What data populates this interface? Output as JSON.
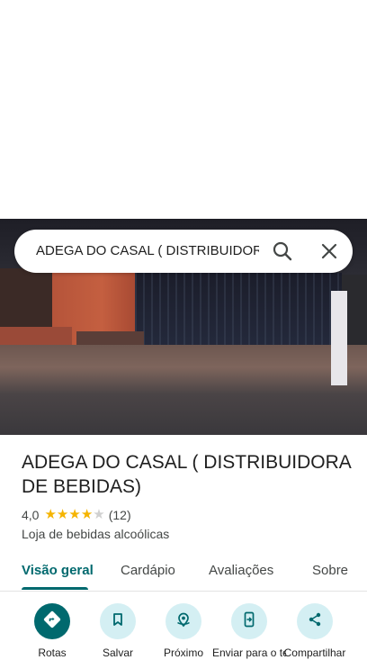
{
  "search": {
    "query": "ADEGA DO CASAL ( DISTRIBUIDORA DE BEBIDAS)"
  },
  "place": {
    "name": "ADEGA DO CASAL ( DISTRIBUIDORA DE BEBIDAS)",
    "rating": "4,0",
    "rating_stars": 4,
    "review_count": "(12)",
    "category": "Loja de bebidas alcoólicas"
  },
  "tabs": [
    {
      "label": "Visão geral",
      "active": true
    },
    {
      "label": "Cardápio",
      "active": false
    },
    {
      "label": "Avaliações",
      "active": false
    },
    {
      "label": "Sobre",
      "active": false
    }
  ],
  "actions": [
    {
      "label": "Rotas",
      "icon": "directions-icon"
    },
    {
      "label": "Salvar",
      "icon": "bookmark-icon"
    },
    {
      "label": "Próximo",
      "icon": "nearby-icon"
    },
    {
      "label": "Enviar para o telefone",
      "icon": "send-to-phone-icon"
    },
    {
      "label": "Compartilhar",
      "icon": "share-icon"
    }
  ],
  "colors": {
    "accent": "#00696e",
    "action_bg": "#d4eff3",
    "star": "#f5b400"
  }
}
